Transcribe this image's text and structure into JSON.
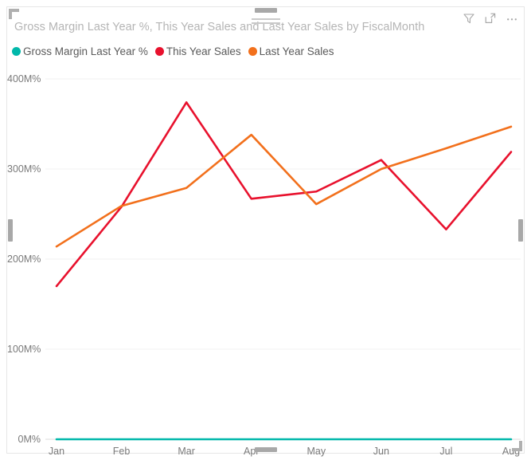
{
  "visual": {
    "title": "Gross Margin Last Year %, This Year Sales and Last Year Sales by FiscalMonth"
  },
  "header": {
    "filter_icon": "filter-icon",
    "focus_icon": "focus-mode-icon",
    "more_icon": "more-options-icon"
  },
  "legend": {
    "items": [
      {
        "label": "Gross Margin Last Year %",
        "color": "#01b8aa"
      },
      {
        "label": "This Year Sales",
        "color": "#e8112d"
      },
      {
        "label": "Last Year Sales",
        "color": "#f2701c"
      }
    ]
  },
  "chart_data": {
    "type": "line",
    "title": "Gross Margin Last Year %, This Year Sales and Last Year Sales by FiscalMonth",
    "xlabel": "FiscalMonth",
    "ylabel": "",
    "categories": [
      "Jan",
      "Feb",
      "Mar",
      "Apr",
      "May",
      "Jun",
      "Jul",
      "Aug"
    ],
    "x_tick_labels": [
      "Jan",
      "Feb",
      "Mar",
      "Apr",
      "May",
      "Jun",
      "Jul",
      "Aug"
    ],
    "y_tick_labels": [
      "400M%",
      "300M%",
      "200M%",
      "100M%",
      "0M%"
    ],
    "y_tick_values": [
      400000000,
      300000000,
      200000000,
      100000000,
      0
    ],
    "ylim": [
      0,
      400000000
    ],
    "y_unit": "M%",
    "grid": true,
    "legend_position": "top-left",
    "series": [
      {
        "name": "Gross Margin Last Year %",
        "color": "#01b8aa",
        "values": [
          0,
          0,
          0,
          0,
          0,
          0,
          0,
          0
        ],
        "values_millions": [
          0,
          0,
          0,
          0,
          0,
          0,
          0,
          0
        ]
      },
      {
        "name": "This Year Sales",
        "color": "#e8112d",
        "values": [
          170000000,
          258000000,
          374000000,
          267000000,
          275000000,
          310000000,
          233000000,
          319000000
        ],
        "values_millions": [
          170,
          258,
          374,
          267,
          275,
          310,
          233,
          319
        ]
      },
      {
        "name": "Last Year Sales",
        "color": "#f2701c",
        "values": [
          214000000,
          259000000,
          279000000,
          338000000,
          261000000,
          300000000,
          323000000,
          347000000
        ],
        "values_millions": [
          214,
          259,
          279,
          338,
          261,
          300,
          323,
          347
        ]
      }
    ]
  }
}
